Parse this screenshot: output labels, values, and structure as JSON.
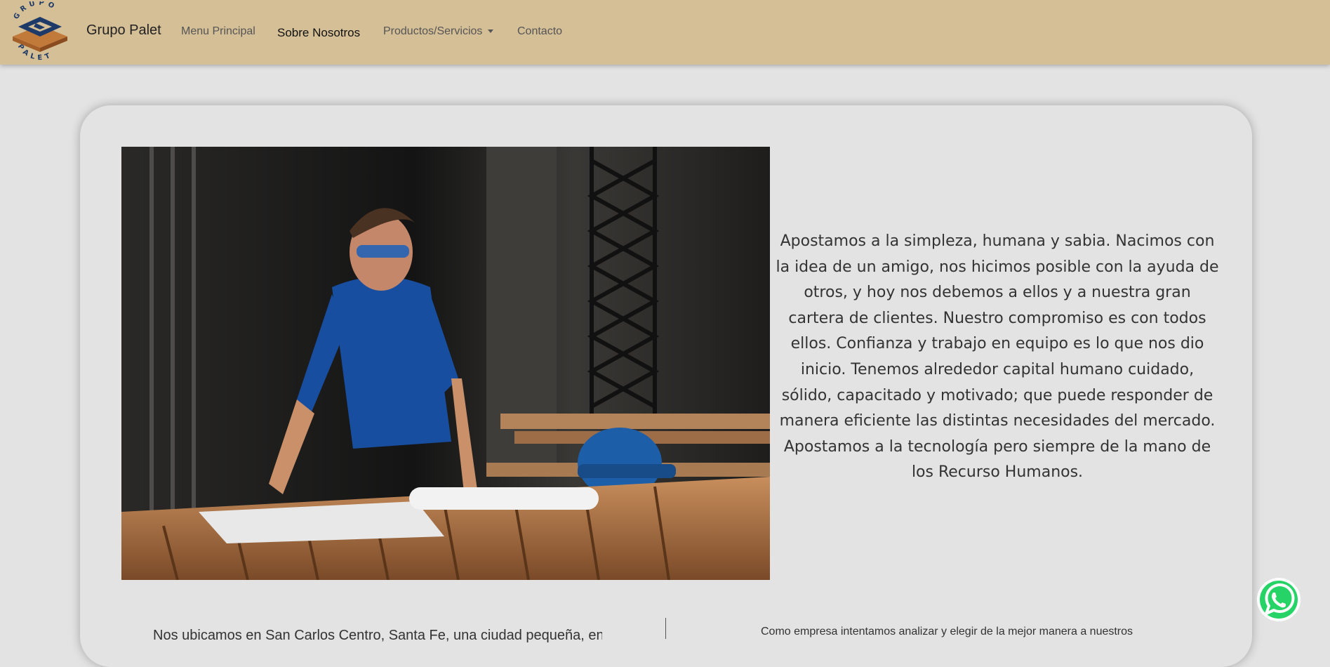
{
  "navbar": {
    "logo_top_text": "GRUPO",
    "logo_bottom_text": "PALET",
    "brand": "Grupo Palet",
    "links": [
      {
        "label": "Menu Principal"
      },
      {
        "label": "Sobre Nosotros",
        "active": true
      },
      {
        "label": "Productos/Servicios",
        "dropdown": true
      },
      {
        "label": "Contacto"
      }
    ]
  },
  "main": {
    "photo_icon": "worker-at-workbench-photo",
    "paragraph": "Apostamos a la simpleza, humana y sabia. Nacimos con la idea de un amigo, nos hicimos posible con la ayuda de otros, y hoy nos debemos a ellos y a nuestra gran cartera de clientes. Nuestro compromiso es con todos ellos. Confianza y trabajo en equipo es lo que nos dio inicio. Tenemos alrededor capital humano cuidado, sólido, capacitado y motivado; que puede responder de manera eficiente las distintas necesidades del mercado. Apostamos a la tecnología pero siempre de la mano de los Recurso Humanos.",
    "bottom_left_text": "Nos ubicamos en San Carlos Centro, Santa Fe, una ciudad pequeña, en",
    "bottom_right_text": "Como empresa intentamos analizar y elegir de la mejor manera a nuestros"
  },
  "whatsapp": {
    "icon": "whatsapp-icon"
  },
  "colors": {
    "navbar": "#d5bf97",
    "background": "#e3e3e3",
    "logo_blue": "#1e3a68",
    "logo_orange": "#c27a3a",
    "whatsapp_green": "#25d366"
  }
}
